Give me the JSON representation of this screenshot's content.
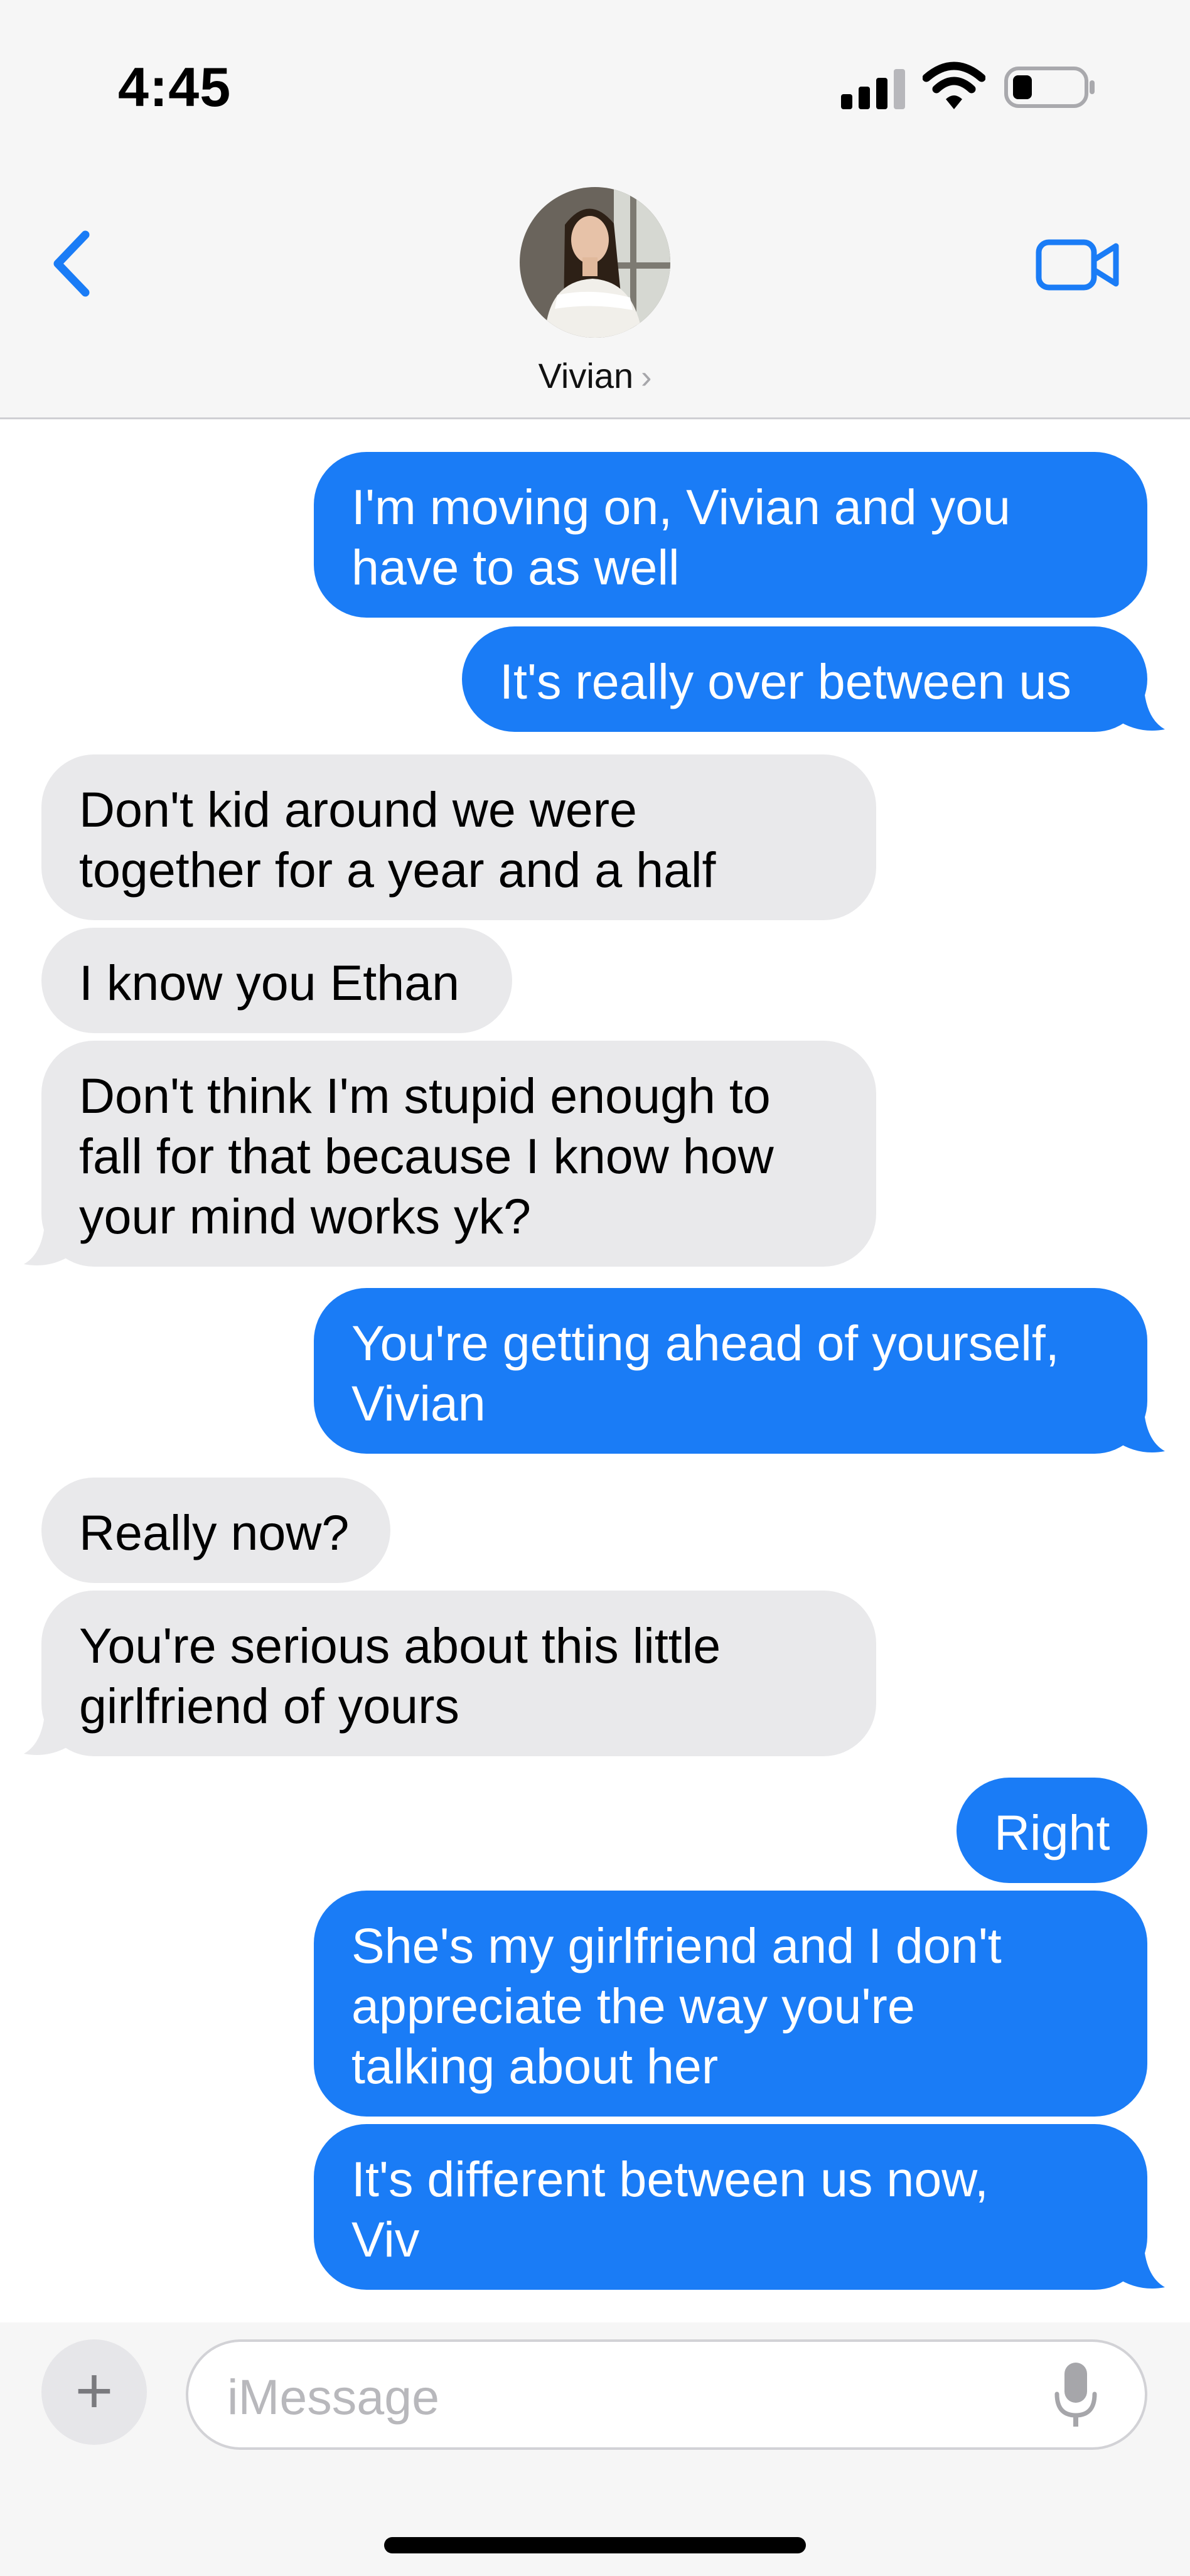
{
  "status_bar": {
    "time": "4:45"
  },
  "header": {
    "contact_name": "Vivian",
    "chevron": "›"
  },
  "messages": [
    {
      "side": "sent",
      "lines": [
        "I'm moving on, Vivian and you",
        "have to as well"
      ]
    },
    {
      "side": "sent",
      "lines": [
        "It's really over between us"
      ]
    },
    {
      "side": "recv",
      "lines": [
        "Don't kid around we were",
        "together for a year and a half"
      ]
    },
    {
      "side": "recv",
      "lines": [
        "I know you Ethan"
      ]
    },
    {
      "side": "recv",
      "lines": [
        "Don't think I'm stupid enough to",
        "fall for that because I know how",
        "your mind works yk?"
      ]
    },
    {
      "side": "sent",
      "lines": [
        "You're getting ahead of yourself,",
        "Vivian"
      ]
    },
    {
      "side": "recv",
      "lines": [
        "Really now?"
      ]
    },
    {
      "side": "recv",
      "lines": [
        "You're serious about this little",
        "girlfriend of yours"
      ]
    },
    {
      "side": "sent",
      "lines": [
        "Right"
      ]
    },
    {
      "side": "sent",
      "lines": [
        "She's my girlfriend and I don't",
        "appreciate the way you're",
        "talking about her"
      ]
    },
    {
      "side": "sent",
      "lines": [
        "It's different between us now,",
        "Viv"
      ]
    }
  ],
  "composer": {
    "placeholder": "iMessage",
    "plus": "+"
  },
  "colors": {
    "accent": "#1a7cf6",
    "sent_bubble": "#1a7cf6",
    "received_bubble": "#e9e9eb",
    "header_bg": "#f6f6f6"
  },
  "icons": [
    "back-chevron-icon",
    "facetime-video-icon",
    "signal-icon",
    "wifi-icon",
    "battery-icon",
    "plus-icon",
    "microphone-icon"
  ]
}
